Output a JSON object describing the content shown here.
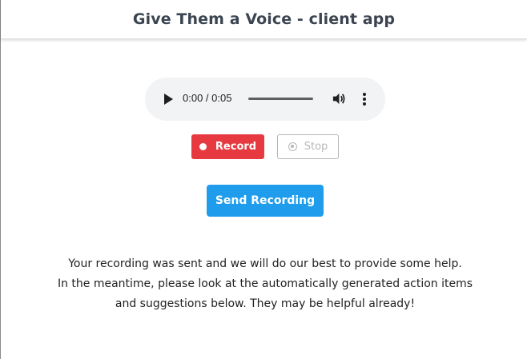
{
  "header": {
    "title": "Give Them a Voice - client app"
  },
  "audio_player": {
    "time_display": "0:00 / 0:05",
    "progress": 0,
    "icons": {
      "play": "play-icon",
      "volume": "volume-icon",
      "more": "more-vert-icon"
    }
  },
  "controls": {
    "record_label": "Record",
    "stop_label": "Stop",
    "send_label": "Send Recording"
  },
  "message": {
    "lines": [
      "Your recording was sent and we will do our best to provide some help.",
      "In the meantime, please look at the automatically generated action items",
      "and suggestions below. They may be helpful already!"
    ]
  },
  "colors": {
    "record": "#e63a40",
    "send": "#1f9ceb",
    "header_text": "#3b4451",
    "player_bg": "#f1f3f4",
    "disabled": "#b7b7b7"
  }
}
